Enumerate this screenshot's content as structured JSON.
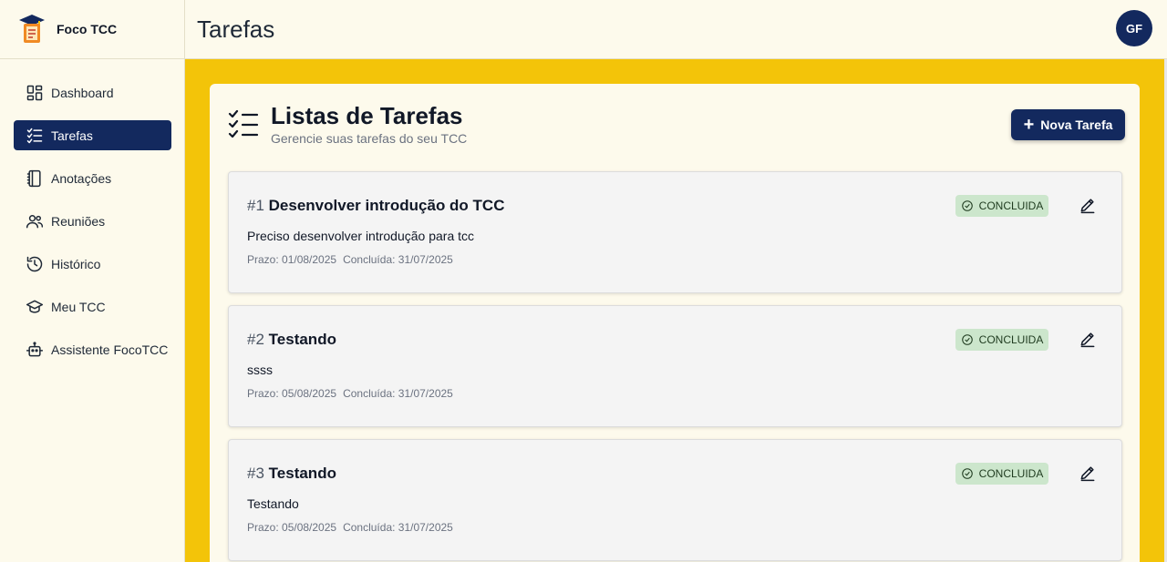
{
  "app": {
    "name": "Foco TCC"
  },
  "header": {
    "title": "Tarefas",
    "avatar_initials": "GF"
  },
  "sidebar": {
    "items": [
      {
        "label": "Dashboard",
        "icon": "dashboard-icon"
      },
      {
        "label": "Tarefas",
        "icon": "checklist-icon",
        "active": true
      },
      {
        "label": "Anotações",
        "icon": "notebook-icon"
      },
      {
        "label": "Reuniões",
        "icon": "users-icon"
      },
      {
        "label": "Histórico",
        "icon": "history-icon"
      },
      {
        "label": "Meu TCC",
        "icon": "graduation-cap-icon"
      },
      {
        "label": "Assistente FocoTCC",
        "icon": "robot-icon"
      }
    ]
  },
  "panel": {
    "title": "Listas de Tarefas",
    "subtitle": "Gerencie suas tarefas do seu TCC",
    "new_button_label": "Nova Tarefa"
  },
  "tasks": [
    {
      "number": "#1",
      "title": "Desenvolver introdução do TCC",
      "description": "Preciso desenvolver introdução para tcc",
      "deadline": "Prazo: 01/08/2025",
      "completed": "Concluída: 31/07/2025",
      "status": "CONCLUIDA"
    },
    {
      "number": "#2",
      "title": "Testando",
      "description": "ssss",
      "deadline": "Prazo: 05/08/2025",
      "completed": "Concluída: 31/07/2025",
      "status": "CONCLUIDA"
    },
    {
      "number": "#3",
      "title": "Testando",
      "description": "Testando",
      "deadline": "Prazo: 05/08/2025",
      "completed": "Concluída: 31/07/2025",
      "status": "CONCLUIDA"
    }
  ],
  "colors": {
    "accent": "#13295e",
    "background": "#fdfaec",
    "main_bg": "#f3c409",
    "badge_bg": "#cce6cc"
  }
}
